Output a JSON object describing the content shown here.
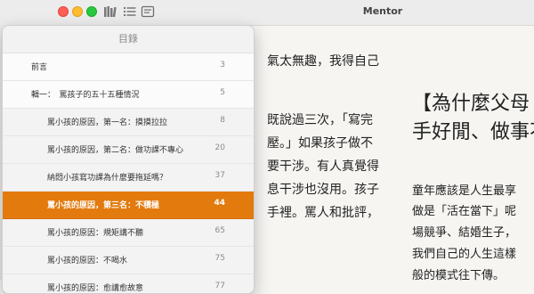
{
  "window": {
    "title": "Mentor"
  },
  "toolbar": {
    "library_icon": "library-icon",
    "toc_icon": "list-icon",
    "notes_icon": "notes-icon"
  },
  "toc": {
    "title": "目錄",
    "items": [
      {
        "label": "前言",
        "page": "3"
      },
      {
        "label": "輯一：　罵孩子的五十五種情況",
        "page": "5"
      },
      {
        "label": "罵小孩的原因，第一名：摸摸拉拉",
        "page": "8"
      },
      {
        "label": "罵小孩的原因，第二名：做功課不專心",
        "page": "20"
      },
      {
        "label": "納悶小孩寫功課為什麼要拖延嗎？",
        "page": "37"
      },
      {
        "label": "罵小孩的原因，第三名：不積極",
        "page": "44"
      },
      {
        "label": "罵小孩的原因：規矩講不聽",
        "page": "65"
      },
      {
        "label": "罵小孩的原因：不喝水",
        "page": "75"
      },
      {
        "label": "罵小孩的原因：愈講愈故意",
        "page": "77"
      }
    ]
  },
  "book": {
    "col1": [
      "氣太無趣，我得自己",
      "既說過三次，「寫完",
      "壓。」如果孩子做不",
      "要干涉。有人真覺得",
      "息干涉也沒用。孩子",
      "手裡。罵人和批評，"
    ],
    "heading": [
      "【為什麼父母",
      "手好閒、做事不"
    ],
    "col2": [
      "童年應該是人生最享",
      "做是「活在當下」呢",
      "場競爭、結婚生子，",
      "我們自己的人生這樣",
      "般的模式往下傳。"
    ]
  },
  "colors": {
    "selected": "#e27a0e",
    "accent_red": "#ff5f57",
    "accent_yellow": "#febc2e",
    "accent_green": "#28c840"
  }
}
